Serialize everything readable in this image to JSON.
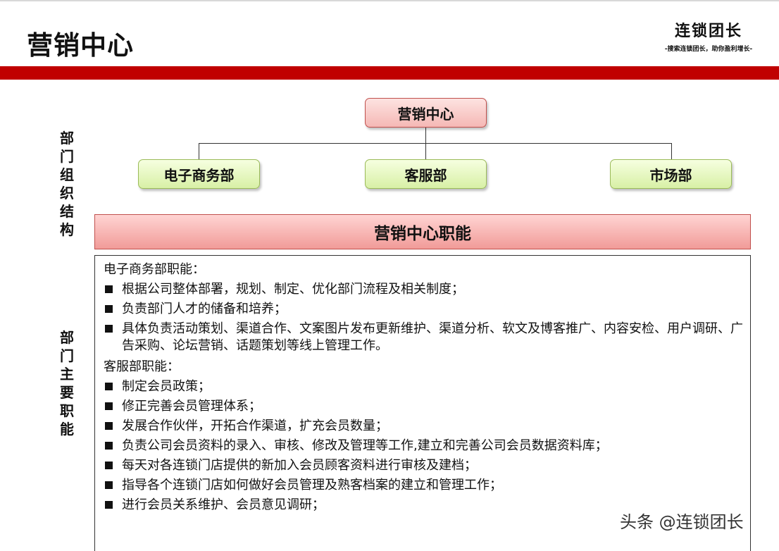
{
  "header": {
    "title": "营销中心",
    "brand_name": "连锁团长",
    "brand_slogan": "-搜索连锁团长，助你盈利增长-"
  },
  "side_labels": {
    "structure": "部门组织结构",
    "duties": "部门主要职能"
  },
  "org_chart": {
    "root": "营销中心",
    "children": [
      "电子商务部",
      "客服部",
      "市场部"
    ]
  },
  "duties_title": "营销中心职能",
  "departments": [
    {
      "heading": "电子商务部职能：",
      "items": [
        "根据公司整体部署，规划、制定、优化部门流程及相关制度；",
        "负责部门人才的储备和培养；",
        "具体负责活动策划、渠道合作、文案图片发布更新维护、渠道分析、软文及博客推广、内容安检、用户调研、广告采购、论坛营销、话题策划等线上管理工作。"
      ]
    },
    {
      "heading": "客服部职能：",
      "items": [
        "制定会员政策；",
        "修正完善会员管理体系；",
        "发展合作伙伴，开拓合作渠道，扩充会员数量；",
        "负责公司会员资料的录入、审核、修改及管理等工作,建立和完善公司会员数据资料库；",
        "每天对各连锁门店提供的新加入会员顾客资料进行审核及建档；",
        "指导各个连锁门店如何做好会员管理及熟客档案的建立和管理工作；",
        "进行会员关系维护、会员意见调研；"
      ]
    }
  ],
  "watermark": "头条 @连锁团长"
}
